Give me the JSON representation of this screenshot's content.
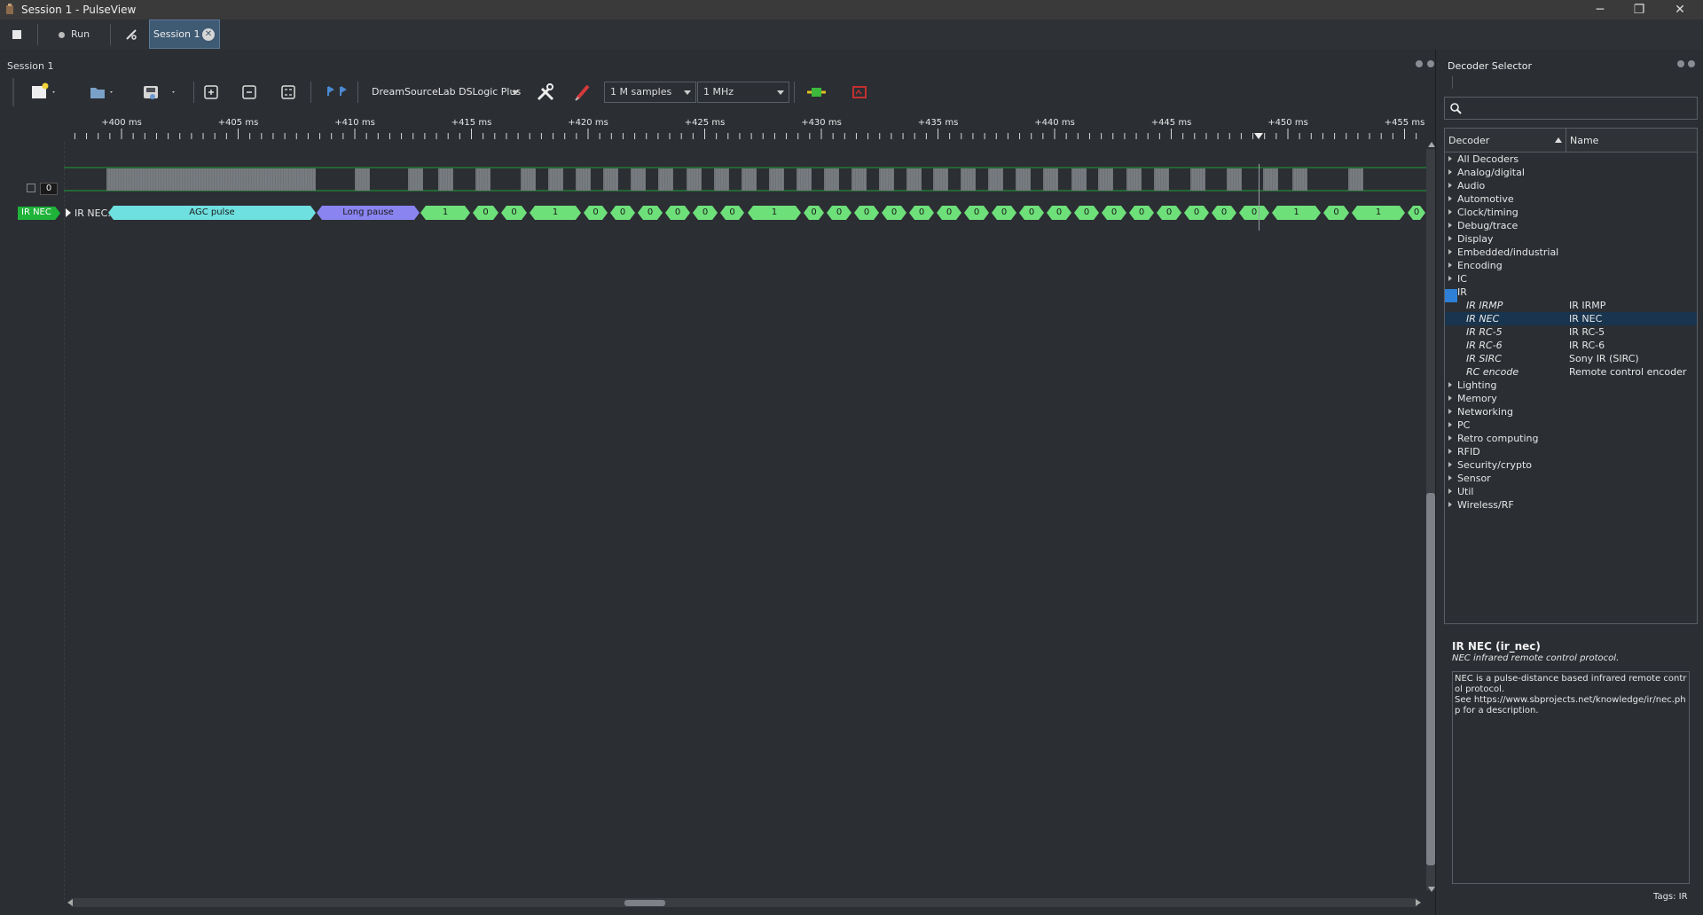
{
  "window": {
    "title": "Session 1 - PulseView",
    "minimize": "─",
    "restore": "❐",
    "close": "✕"
  },
  "tabbar": {
    "stop_icon": "stop-icon",
    "run_label": "Run",
    "session_tab_label": "Session 1"
  },
  "main": {
    "panel_title": "Session 1"
  },
  "toolbar": {
    "device": "DreamSourceLab DSLogic Plus",
    "samples": "1 M samples",
    "samplerate": "1 MHz"
  },
  "ruler": {
    "ticks": [
      "+400 ms",
      "+405 ms",
      "+410 ms",
      "+415 ms",
      "+420 ms",
      "+425 ms",
      "+430 ms",
      "+435 ms",
      "+440 ms",
      "+445 ms",
      "+450 ms",
      "+455 ms"
    ]
  },
  "trace": {
    "channel_index": "0",
    "decoder_badge": "IR NEC",
    "row_label": "IR NEC: Bits",
    "agc_label": "AGC pulse",
    "pause_label": "Long pause",
    "bits": [
      "1",
      "0",
      "0",
      "1",
      "0",
      "0",
      "0",
      "0",
      "0",
      "0",
      "1",
      "0",
      "0",
      "0",
      "0",
      "0",
      "0",
      "0",
      "0",
      "0",
      "0",
      "0",
      "0",
      "0",
      "0",
      "0",
      "0",
      "0",
      "1",
      "0",
      "1",
      "0"
    ]
  },
  "decoder_selector": {
    "title": "Decoder Selector",
    "search_placeholder": "",
    "col_decoder": "Decoder",
    "col_name": "Name",
    "categories": [
      {
        "label": "All Decoders"
      },
      {
        "label": "Analog/digital"
      },
      {
        "label": "Audio"
      },
      {
        "label": "Automotive"
      },
      {
        "label": "Clock/timing"
      },
      {
        "label": "Debug/trace"
      },
      {
        "label": "Display"
      },
      {
        "label": "Embedded/industrial"
      },
      {
        "label": "Encoding"
      },
      {
        "label": "IC"
      },
      {
        "label": "IR"
      }
    ],
    "ir_children": [
      {
        "id": "IR IRMP",
        "name": "IR IRMP"
      },
      {
        "id": "IR NEC",
        "name": "IR NEC"
      },
      {
        "id": "IR RC-5",
        "name": "IR RC-5"
      },
      {
        "id": "IR RC-6",
        "name": "IR RC-6"
      },
      {
        "id": "IR SIRC",
        "name": "Sony IR (SIRC)"
      },
      {
        "id": "RC encode",
        "name": "Remote control encoder"
      }
    ],
    "categories_after": [
      {
        "label": "Lighting"
      },
      {
        "label": "Memory"
      },
      {
        "label": "Networking"
      },
      {
        "label": "PC"
      },
      {
        "label": "Retro computing"
      },
      {
        "label": "RFID"
      },
      {
        "label": "Security/crypto"
      },
      {
        "label": "Sensor"
      },
      {
        "label": "Util"
      },
      {
        "label": "Wireless/RF"
      }
    ],
    "selected_title": "IR NEC (ir_nec)",
    "selected_subtitle": "NEC infrared remote control protocol.",
    "description": "NEC is a pulse-distance based infrared remote control protocol.\nSee https://www.sbprojects.net/knowledge/ir/nec.php for a description.",
    "tags": "Tags: IR"
  },
  "colors": {
    "agc": "#6fe0e0",
    "pause": "#8a84f0",
    "bit": "#6ee07a",
    "badge": "#1fb33a"
  }
}
